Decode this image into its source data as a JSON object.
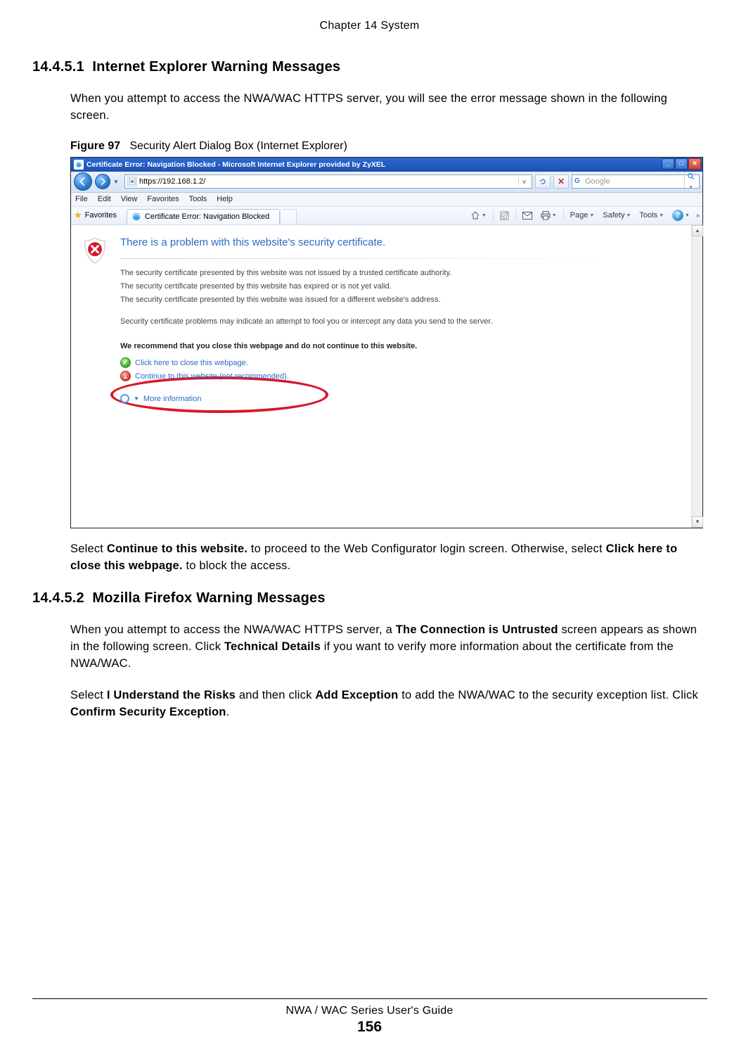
{
  "page": {
    "chapter_header": "Chapter 14 System",
    "footer_guide": "NWA / WAC Series User's Guide",
    "footer_page": "156"
  },
  "section1": {
    "number": "14.4.5.1",
    "title": "Internet Explorer Warning Messages",
    "intro": "When you attempt to access the NWA/WAC HTTPS server, you will see the error message shown in the following screen.",
    "figure_label": "Figure 97",
    "figure_caption": "Security Alert Dialog Box (Internet Explorer)",
    "after_text_pre": "Select ",
    "after_bold1": "Continue to this website.",
    "after_text_mid": " to proceed to the Web Configurator login screen. Otherwise, select ",
    "after_bold2": "Click here to close this webpage.",
    "after_text_post": " to block the access."
  },
  "ie": {
    "window_title": "Certificate Error: Navigation Blocked - Microsoft Internet Explorer provided by ZyXEL",
    "url": "https://192.168.1.2/",
    "search_placeholder": "Google",
    "menubar": [
      "File",
      "Edit",
      "View",
      "Favorites",
      "Tools",
      "Help"
    ],
    "favorites_label": "Favorites",
    "tab_title": "Certificate Error: Navigation Blocked",
    "cmdbar": {
      "page": "Page",
      "safety": "Safety",
      "tools": "Tools"
    },
    "cert": {
      "heading": "There is a problem with this website's security certificate.",
      "line1": "The security certificate presented by this website was not issued by a trusted certificate authority.",
      "line2": "The security certificate presented by this website has expired or is not yet valid.",
      "line3": "The security certificate presented by this website was issued for a different website's address.",
      "warn": "Security certificate problems may indicate an attempt to fool you or intercept any data you send to the server.",
      "recommend": "We recommend that you close this webpage and do not continue to this website.",
      "close_link": "Click here to close this webpage.",
      "continue_link": "Continue to this website (not recommended).",
      "more_info": "More information"
    }
  },
  "section2": {
    "number": "14.4.5.2",
    "title": "Mozilla Firefox Warning Messages",
    "p1_pre": "When you attempt to access the NWA/WAC HTTPS server, a ",
    "p1_b1": "The Connection is Untrusted",
    "p1_mid": " screen appears as shown in the following screen. Click ",
    "p1_b2": "Technical Details",
    "p1_post": " if you want to verify more information about the certificate from the NWA/WAC.",
    "p2_pre": "Select ",
    "p2_b1": "I Understand the Risks",
    "p2_mid": " and then click ",
    "p2_b2": "Add Exception",
    "p2_mid2": " to add the NWA/WAC to the security exception list. Click ",
    "p2_b3": "Confirm Security Exception",
    "p2_post": "."
  }
}
